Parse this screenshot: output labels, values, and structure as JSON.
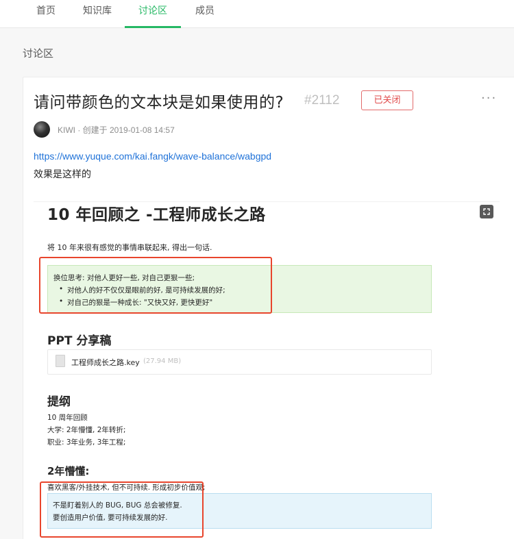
{
  "nav": {
    "tabs": [
      {
        "label": "首页"
      },
      {
        "label": "知识库"
      },
      {
        "label": "讨论区"
      },
      {
        "label": "成员"
      }
    ],
    "active_index": 2
  },
  "section_title": "讨论区",
  "post": {
    "title": "请问带颜色的文本块是如果使用的?",
    "number": "#2112",
    "status": "已关闭",
    "more": "···",
    "author": "KIWI",
    "created_meta": " · 创建于 2019-01-08 14:57",
    "link": "https://www.yuque.com/kai.fangk/wave-balance/wabgpd",
    "description": "效果是这样的"
  },
  "screenshot": {
    "doc_title": "10 年回顾之 -工程师成长之路",
    "intro": "将 10 年来很有感觉的事情串联起来, 得出一句话.",
    "green_block": {
      "line1": "换位思考: 对他人更好一些, 对自己更狠一些;",
      "bullets": [
        "对他人的好不仅仅是眼前的好, 是可持续发展的好;",
        "对自己的狠是一种成长: \"又快又好, 更快更好\""
      ]
    },
    "ppt_heading": "PPT 分享稿",
    "file": {
      "name": "工程师成长之路.key",
      "size": "(27.94 MB)"
    },
    "outline_heading": "提纲",
    "outline_lines": [
      "10 周年回顾",
      "大学: 2年懵懂, 2年转折;",
      "职业: 3年业务, 3年工程;"
    ],
    "ignorance_heading": "2年懵懂:",
    "ignorance_line": "喜欢黑客/外挂技术, 但不可持续. 形成初步价值观;",
    "blue_block": [
      "不是盯着别人的 BUG, BUG 总会被修复.",
      "要创造用户价值, 要可持续发展的好."
    ]
  },
  "colors": {
    "accent": "#25b864",
    "closed_badge": "#e14b4b",
    "link": "#1f72d8",
    "annotation_red": "#e8452c",
    "green_block": "#e9f7e3",
    "blue_block": "#e6f4fb"
  }
}
